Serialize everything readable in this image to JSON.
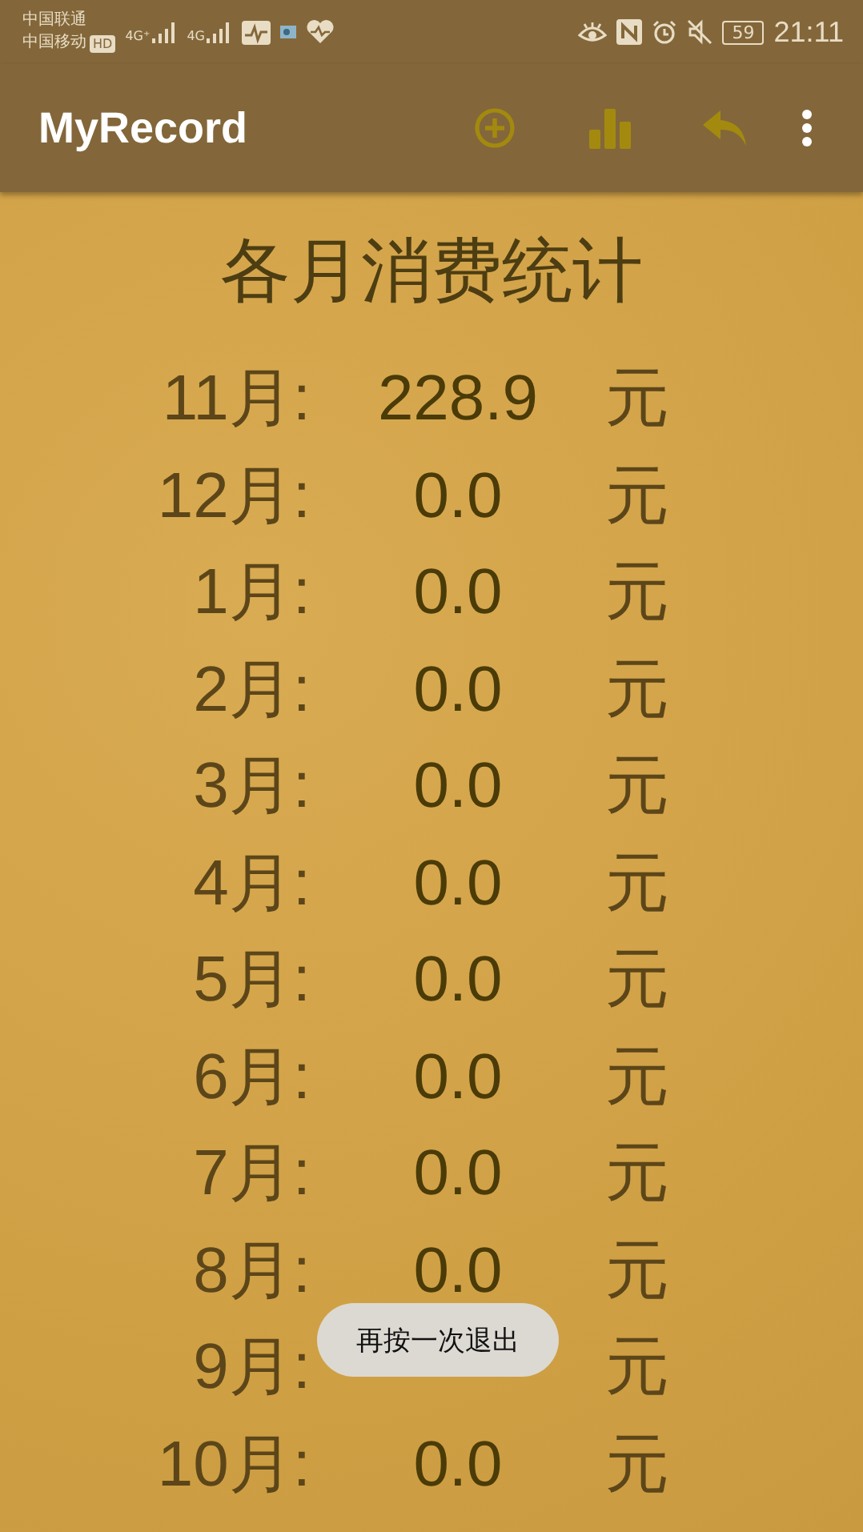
{
  "status_bar": {
    "carriers": [
      "中国联通",
      "中国移动"
    ],
    "hd": "HD",
    "networks": [
      "4G⁺",
      "4G"
    ],
    "battery": "59",
    "time": "21:11"
  },
  "toolbar": {
    "title": "MyRecord"
  },
  "heading": "各月消费统计",
  "rows": [
    {
      "month": "11月:",
      "amount": "228.9",
      "unit": "元"
    },
    {
      "month": "12月:",
      "amount": "0.0",
      "unit": "元"
    },
    {
      "month": "1月:",
      "amount": "0.0",
      "unit": "元"
    },
    {
      "month": "2月:",
      "amount": "0.0",
      "unit": "元"
    },
    {
      "month": "3月:",
      "amount": "0.0",
      "unit": "元"
    },
    {
      "month": "4月:",
      "amount": "0.0",
      "unit": "元"
    },
    {
      "month": "5月:",
      "amount": "0.0",
      "unit": "元"
    },
    {
      "month": "6月:",
      "amount": "0.0",
      "unit": "元"
    },
    {
      "month": "7月:",
      "amount": "0.0",
      "unit": "元"
    },
    {
      "month": "8月:",
      "amount": "0.0",
      "unit": "元"
    },
    {
      "month": "9月:",
      "unit": "元"
    },
    {
      "month": "10月:",
      "amount": "0.0",
      "unit": "元"
    }
  ],
  "toast": "再按一次退出"
}
